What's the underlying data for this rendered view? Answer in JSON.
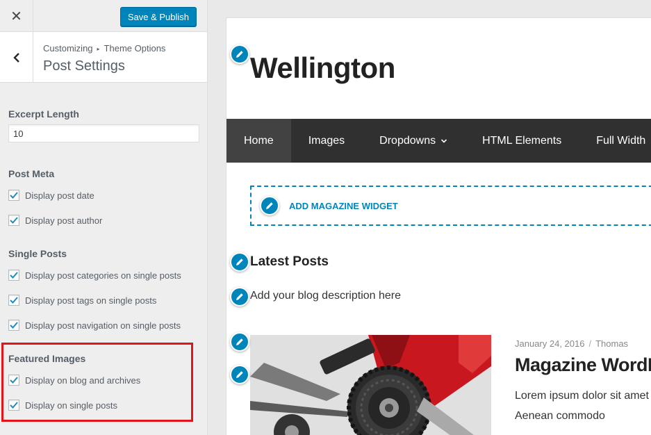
{
  "sidebar": {
    "close_symbol": "✕",
    "publish_label": "Save & Publish",
    "breadcrumb": {
      "first": "Customizing",
      "separator": "▸",
      "second": "Theme Options"
    },
    "section_title": "Post Settings",
    "excerpt": {
      "label": "Excerpt Length",
      "value": "10"
    },
    "post_meta": {
      "title": "Post Meta",
      "options": [
        {
          "label": "Display post date",
          "checked": true
        },
        {
          "label": "Display post author",
          "checked": true
        }
      ]
    },
    "single_posts": {
      "title": "Single Posts",
      "options": [
        {
          "label": "Display post categories on single posts",
          "checked": true
        },
        {
          "label": "Display post tags on single posts",
          "checked": true
        },
        {
          "label": "Display post navigation on single posts",
          "checked": true
        }
      ]
    },
    "featured_images": {
      "title": "Featured Images",
      "options": [
        {
          "label": "Display on blog and archives",
          "checked": true
        },
        {
          "label": "Display on single posts",
          "checked": true
        }
      ]
    },
    "highlight_color": "#e3151a"
  },
  "preview": {
    "site_title": "Wellington",
    "nav": [
      {
        "label": "Home",
        "active": true
      },
      {
        "label": "Images"
      },
      {
        "label": "Dropdowns",
        "has_dropdown": true
      },
      {
        "label": "HTML Elements"
      },
      {
        "label": "Full Width"
      }
    ],
    "widget_label": "ADD MAGAZINE WIDGET",
    "latest_title": "Latest Posts",
    "blog_description": "Add your blog description here",
    "post": {
      "date": "January 24, 2016",
      "meta_separator": "/",
      "author": "Thomas",
      "title": "Magazine WordPress",
      "excerpt_line1": "Lorem ipsum dolor sit amet",
      "excerpt_line2": "Aenean commodo"
    }
  },
  "colors": {
    "accent": "#0085ba",
    "nav_bg": "#303030",
    "nav_active": "#424242",
    "bike_frame": "#c8171e"
  }
}
